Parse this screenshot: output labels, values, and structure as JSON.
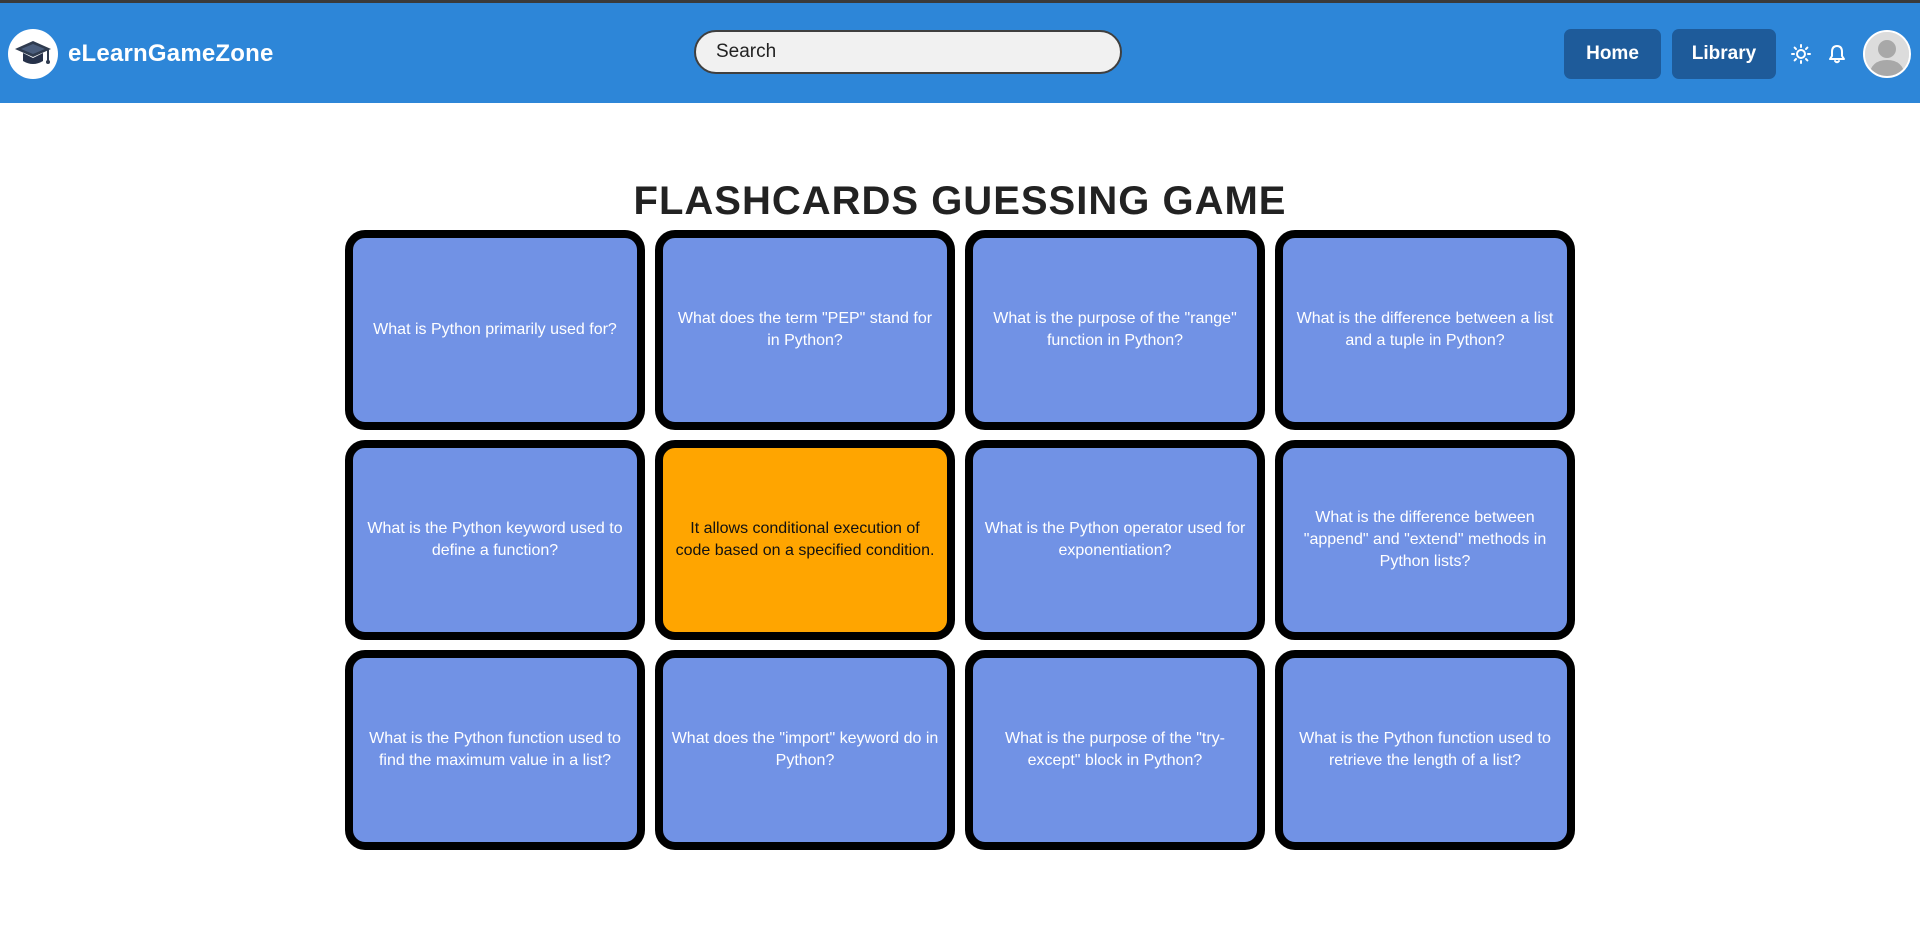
{
  "app": {
    "brand_name": "eLearnGameZone"
  },
  "navbar": {
    "search_placeholder": "Search",
    "home_label": "Home",
    "library_label": "Library",
    "icons": [
      "graduation-cap-icon",
      "sun-icon",
      "bell-icon",
      "user-avatar-icon"
    ]
  },
  "page": {
    "title": "FLASHCARDS GUESSING GAME"
  },
  "cards": [
    {
      "text": "What is Python primarily used for?",
      "flipped": false
    },
    {
      "text": "What does the term \"PEP\" stand for in Python?",
      "flipped": false
    },
    {
      "text": "What is the purpose of the \"range\" function in Python?",
      "flipped": false
    },
    {
      "text": "What is the difference between a list and a tuple in Python?",
      "flipped": false
    },
    {
      "text": "What is the Python keyword used to define a function?",
      "flipped": false
    },
    {
      "text": "It allows conditional execution of code based on a specified condition.",
      "flipped": true
    },
    {
      "text": "What is the Python operator used for exponentiation?",
      "flipped": false
    },
    {
      "text": "What is the difference between \"append\" and \"extend\" methods in Python lists?",
      "flipped": false
    },
    {
      "text": "What is the Python function used to find the maximum value in a list?",
      "flipped": false
    },
    {
      "text": "What does the \"import\" keyword do in Python?",
      "flipped": false
    },
    {
      "text": "What is the purpose of the \"try-except\" block in Python?",
      "flipped": false
    },
    {
      "text": "What is the Python function used to retrieve the length of a list?",
      "flipped": false
    }
  ],
  "colors": {
    "navbar": "#2d86d8",
    "nav_button": "#1e5b9a",
    "card_front": "#7192e5",
    "card_flipped": "#ffa500",
    "card_border": "#000000"
  }
}
